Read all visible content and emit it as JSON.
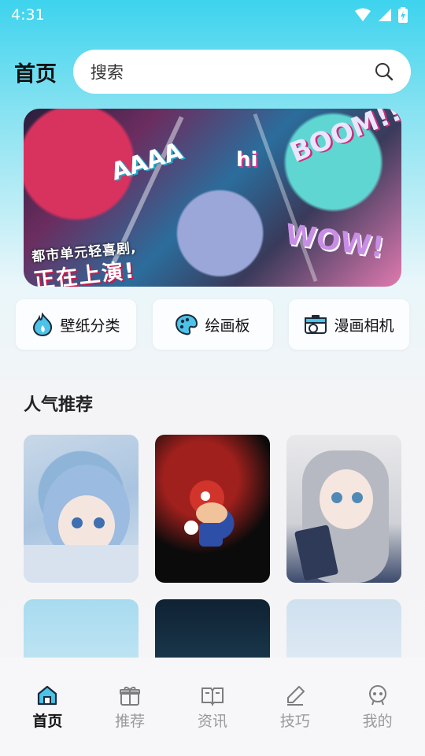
{
  "status_bar": {
    "time": "4:31"
  },
  "header": {
    "title": "首页",
    "search_placeholder": "搜索"
  },
  "banner": {
    "caption_line1": "都市单元轻喜剧,",
    "caption_line2": "正在上演!",
    "word_aaaa": "AAAA",
    "word_hi": "hi",
    "word_boom": "BOOM!!",
    "word_wow": "WOW!"
  },
  "quick_actions": [
    {
      "label": "壁纸分类",
      "icon": "fire-drop-icon"
    },
    {
      "label": "绘画板",
      "icon": "palette-icon"
    },
    {
      "label": "漫画相机",
      "icon": "camera-icon"
    }
  ],
  "section": {
    "title": "人气推荐"
  },
  "tab_bar": {
    "items": [
      {
        "label": "首页",
        "icon": "home-icon",
        "active": true
      },
      {
        "label": "推荐",
        "icon": "gift-icon",
        "active": false
      },
      {
        "label": "资讯",
        "icon": "book-icon",
        "active": false
      },
      {
        "label": "技巧",
        "icon": "pen-icon",
        "active": false
      },
      {
        "label": "我的",
        "icon": "profile-icon",
        "active": false
      }
    ]
  },
  "colors": {
    "accent": "#3dd3ee",
    "active_tab": "#111111",
    "inactive_tab": "#9a9a9a"
  }
}
